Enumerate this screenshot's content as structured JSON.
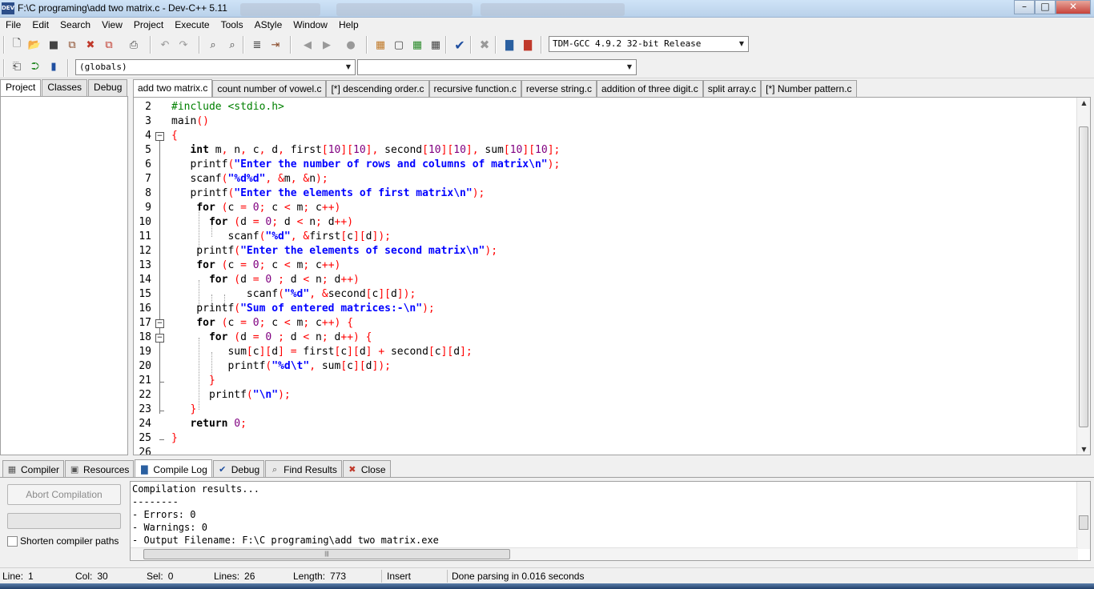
{
  "window": {
    "title": "F:\\C programing\\add two matrix.c - Dev-C++ 5.11",
    "app_icon_text": "DEV"
  },
  "menu": [
    "File",
    "Edit",
    "Search",
    "View",
    "Project",
    "Execute",
    "Tools",
    "AStyle",
    "Window",
    "Help"
  ],
  "toolbar": {
    "compiler_select": "TDM-GCC 4.9.2 32-bit Release",
    "scope_select": "(globals)",
    "function_select": ""
  },
  "left_tabs": [
    "Project",
    "Classes",
    "Debug"
  ],
  "file_tabs": [
    "add two matrix.c",
    "count number of vowel.c",
    "[*] descending order.c",
    "recursive function.c",
    "reverse string.c",
    "addition of three digit.c",
    "split array.c",
    "[*] Number pattern.c"
  ],
  "editor": {
    "line_numbers": [
      "2",
      "3",
      "4",
      "5",
      "6",
      "7",
      "8",
      "9",
      "10",
      "11",
      "12",
      "13",
      "14",
      "15",
      "16",
      "17",
      "18",
      "19",
      "20",
      "21",
      "22",
      "23",
      "24",
      "25",
      "26"
    ],
    "code_lines": [
      "#include <stdio.h>",
      "main()",
      "{",
      "   int m, n, c, d, first[10][10], second[10][10], sum[10][10];",
      "   printf(\"Enter the number of rows and columns of matrix\\n\");",
      "   scanf(\"%d%d\", &m, &n);",
      "   printf(\"Enter the elements of first matrix\\n\");",
      "    for (c = 0; c < m; c++)",
      "      for (d = 0; d < n; d++)",
      "         scanf(\"%d\", &first[c][d]);",
      "    printf(\"Enter the elements of second matrix\\n\");",
      "    for (c = 0; c < m; c++)",
      "      for (d = 0 ; d < n; d++)",
      "            scanf(\"%d\", &second[c][d]);",
      "    printf(\"Sum of entered matrices:-\\n\");",
      "    for (c = 0; c < m; c++) {",
      "      for (d = 0 ; d < n; d++) {",
      "         sum[c][d] = first[c][d] + second[c][d];",
      "         printf(\"%d\\t\", sum[c][d]);",
      "      }",
      "      printf(\"\\n\");",
      "   }",
      "   return 0;",
      "}",
      ""
    ]
  },
  "bottom_tabs": [
    "Compiler",
    "Resources",
    "Compile Log",
    "Debug",
    "Find Results",
    "Close"
  ],
  "compile_panel": {
    "abort_label": "Abort Compilation",
    "shorten_label": "Shorten compiler paths",
    "log_lines": [
      "Compilation results...",
      "--------",
      "- Errors: 0",
      "- Warnings: 0",
      "- Output Filename: F:\\C programing\\add two matrix.exe"
    ]
  },
  "status": {
    "line_label": "Line:",
    "line_value": "1",
    "col_label": "Col:",
    "col_value": "30",
    "sel_label": "Sel:",
    "sel_value": "0",
    "lines_label": "Lines:",
    "lines_value": "26",
    "length_label": "Length:",
    "length_value": "773",
    "mode": "Insert",
    "message": "Done parsing in 0.016 seconds"
  },
  "colors": {
    "keyword": "#000000",
    "string": "#0000ff",
    "symbol": "#ff0000",
    "number": "#800080",
    "preprocessor": "#008000"
  }
}
